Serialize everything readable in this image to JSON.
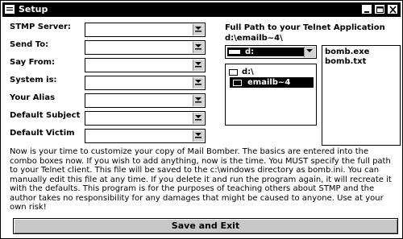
{
  "window": {
    "title": "Setup"
  },
  "fields": [
    {
      "label": "STMP Server:",
      "value": ""
    },
    {
      "label": "Send To:",
      "value": ""
    },
    {
      "label": "Say From:",
      "value": ""
    },
    {
      "label": "System is:",
      "value": ""
    },
    {
      "label": "Your Alias",
      "value": ""
    },
    {
      "label": "Default Subject",
      "value": ""
    },
    {
      "label": "Default Victim",
      "value": ""
    }
  ],
  "path_panel": {
    "heading": "Full Path to your Telnet Application",
    "current_path": "d:\\emailb~4\\",
    "drive": "d:",
    "directories": [
      "d:\\",
      "emailb~4"
    ],
    "files": [
      "bomb.exe",
      "bomb.txt"
    ]
  },
  "description": "Now is your time to customize your copy of Mail Bomber. The basics are entered into the combo boxes now. If you wish to add anything, now is the time. You MUST specify the full path to your Telnet client. This file will be saved to the c:\\windows directory as bomb.ini. You can manually edit this file at any time. If you delete it and run the program again, it will recreate it with the defaults. This program is for the purposes of teaching others about STMP and the author takes no responsibility for any damages that might be caused to anyone. Use at your own risk!",
  "buttons": {
    "save_exit": "Save and Exit"
  }
}
